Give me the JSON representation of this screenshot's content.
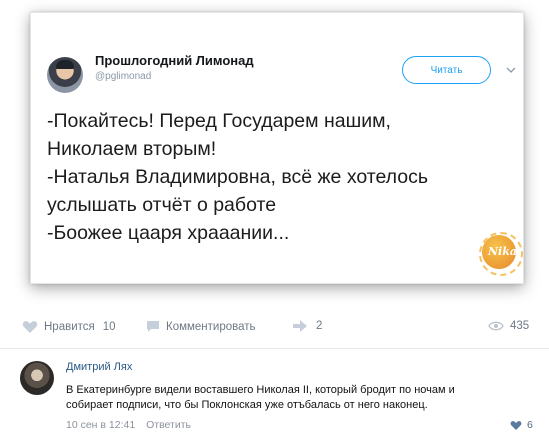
{
  "tweet": {
    "author_name": "Прошлогодний Лимонад",
    "handle": "@pglimonad",
    "follow_label": "Читать",
    "lines": [
      "-Покайтесь! Перед Государем нашим,",
      "Николаем вторым!",
      "-Наталья Владимировна, всё же хотелось",
      "услышать отчёт о работе",
      "-Боожее цааря храаании..."
    ],
    "watermark_text": "Nika"
  },
  "actions": {
    "like_label": "Нравится",
    "like_count": "10",
    "comment_label": "Комментировать",
    "share_count": "2",
    "views_count": "435"
  },
  "comment": {
    "author": "Дмитрий Лях",
    "lines": [
      "В Екатеринбурге видели воставшего Николая II, который бродит по ночам и",
      "собирает подписи, что бы Поклонская уже отъбалась от него наконец."
    ],
    "date": "10 сен в 12:41",
    "reply_label": "Ответить",
    "like_count": "6"
  },
  "colors": {
    "twitter_blue": "#1da1f2",
    "vk_link": "#2a5885",
    "muted": "#6f7985"
  },
  "icons": [
    "avatar",
    "chevron-down-icon",
    "heart-icon",
    "comment-icon",
    "share-icon",
    "eye-icon"
  ]
}
